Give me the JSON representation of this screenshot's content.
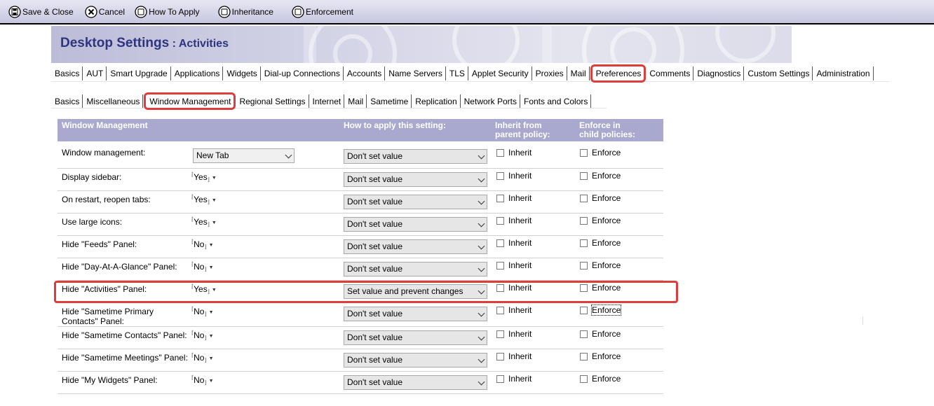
{
  "toolbar": {
    "save_close": "Save & Close",
    "cancel": "Cancel",
    "how_to_apply": "How To Apply",
    "inheritance": "Inheritance",
    "enforcement": "Enforcement"
  },
  "banner": {
    "title": "Desktop Settings",
    "separator": " : ",
    "subtitle": "Activities"
  },
  "main_tabs": [
    "Basics",
    "AUT",
    "Smart Upgrade",
    "Applications",
    "Widgets",
    "Dial-up Connections",
    "Accounts",
    "Name Servers",
    "TLS",
    "Applet Security",
    "Proxies",
    "Mail",
    "Preferences",
    "Comments",
    "Diagnostics",
    "Custom Settings",
    "Administration"
  ],
  "sub_tabs": [
    "Basics",
    "Miscellaneous",
    "Window Management",
    "Regional Settings",
    "Internet",
    "Mail",
    "Sametime",
    "Replication",
    "Network Ports",
    "Fonts and Colors"
  ],
  "table": {
    "headers": {
      "section": "Window Management",
      "how": "How to apply this setting:",
      "inherit_1": "Inherit from",
      "inherit_2": "parent policy:",
      "enforce_1": "Enforce in",
      "enforce_2": "child policies:"
    },
    "inherit_label": "Inherit",
    "enforce_label": "Enforce",
    "rows": [
      {
        "label": "Window management:",
        "value": "New Tab",
        "how": "Don't set value"
      },
      {
        "label": "Display sidebar:",
        "value": "Yes",
        "how": "Don't set value"
      },
      {
        "label": "On restart, reopen tabs:",
        "value": "Yes",
        "how": "Don't set value"
      },
      {
        "label": "Use large icons:",
        "value": "Yes",
        "how": "Don't set value"
      },
      {
        "label": "Hide \"Feeds\" Panel:",
        "value": "No",
        "how": "Don't set value"
      },
      {
        "label": "Hide \"Day-At-A-Glance\" Panel:",
        "value": "No",
        "how": "Don't set value"
      },
      {
        "label": "Hide \"Activities\" Panel:",
        "value": "Yes",
        "how": "Set value and prevent changes"
      },
      {
        "label": "Hide \"Sametime Primary Contacts\" Panel:",
        "value": "No",
        "how": "Don't set value"
      },
      {
        "label": "Hide \"Sametime Contacts\" Panel:",
        "value": "No",
        "how": "Don't set value"
      },
      {
        "label": "Hide \"Sametime Meetings\" Panel:",
        "value": "No",
        "how": "Don't set value"
      },
      {
        "label": "Hide \"My Widgets\" Panel:",
        "value": "No",
        "how": "Don't set value"
      }
    ]
  },
  "colors": {
    "header_bg": "#a9a9d0",
    "highlight": "#dc3d3d",
    "title": "#2e3480"
  }
}
